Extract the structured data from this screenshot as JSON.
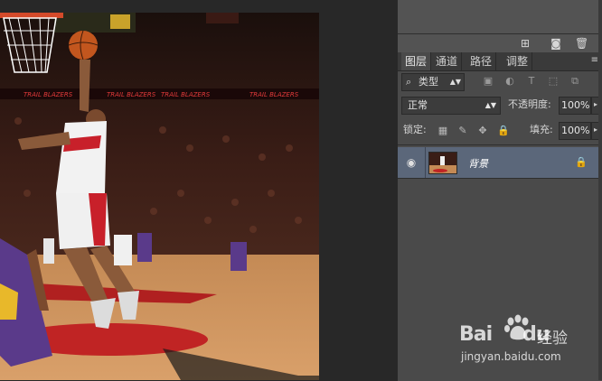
{
  "panel": {
    "tabs": [
      {
        "label": "图层",
        "active": true
      },
      {
        "label": "通道",
        "active": false
      },
      {
        "label": "路径",
        "active": false
      },
      {
        "label": "调整",
        "active": false
      }
    ],
    "filter": {
      "label": "类型",
      "icons": [
        "image-filter-icon",
        "adjustment-filter-icon",
        "type-filter-icon",
        "shape-filter-icon",
        "smart-object-filter-icon"
      ]
    },
    "blend_mode": "正常",
    "opacity_label": "不透明度:",
    "opacity_value": "100%",
    "lock_label": "锁定:",
    "fill_label": "填充:",
    "fill_value": "100%",
    "layers": [
      {
        "name": "背景",
        "visible": true,
        "locked": true
      }
    ]
  },
  "canvas": {
    "arena_banner_text": "TRAIL BLAZERS"
  },
  "watermark": {
    "logo_text": "Bai",
    "logo_text_2": "du",
    "cn_text": "经验",
    "url": "jingyan.baidu.com"
  },
  "colors": {
    "panel_bg": "#4a4a4a",
    "selected_layer": "#5b677a",
    "workspace_bg": "#282828"
  }
}
